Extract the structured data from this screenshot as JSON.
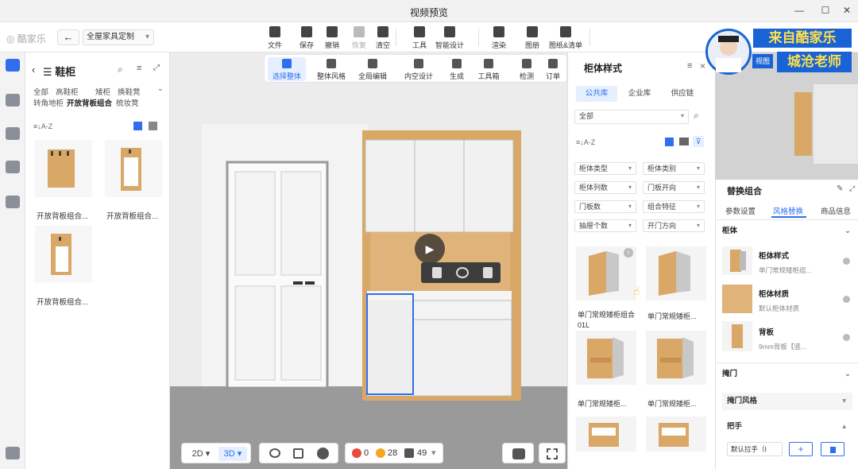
{
  "window": {
    "title": "视频预览",
    "controls": [
      "—",
      "☐",
      "✕"
    ]
  },
  "toolbar": {
    "logo": "酷家乐",
    "back": "←",
    "mode": "全屋家具定制",
    "tools": [
      {
        "label": "文件",
        "dim": false
      },
      {
        "label": "保存",
        "dim": false
      },
      {
        "label": "撤销",
        "dim": false
      },
      {
        "label": "恢复",
        "dim": true
      },
      {
        "label": "清空",
        "dim": false
      },
      {
        "label": "工具",
        "dim": false
      },
      {
        "label": "智能设计",
        "dim": false
      },
      {
        "label": "渲染",
        "dim": false
      },
      {
        "label": "图册",
        "dim": false
      },
      {
        "label": "图纸&清单",
        "dim": false
      }
    ]
  },
  "leftpanel": {
    "title": "鞋柜",
    "categories": [
      [
        "全部",
        "高鞋柜",
        "矮柜",
        "换鞋凳"
      ],
      [
        "转角地柜",
        "开放背板组合",
        "梳妆凳"
      ]
    ],
    "selected_category": "开放背板组合",
    "sort": "A-Z",
    "items": [
      {
        "label": "开放背板组合..."
      },
      {
        "label": "开放背板组合..."
      },
      {
        "label": "开放背板组合..."
      }
    ]
  },
  "center_toolbar": [
    {
      "label": "选择整体",
      "active": true
    },
    {
      "label": "整体风格",
      "active": false
    },
    {
      "label": "全局编辑",
      "active": false
    },
    {
      "label": "内空设计",
      "active": false
    },
    {
      "label": "生成",
      "active": false
    },
    {
      "label": "工具箱",
      "active": false
    },
    {
      "label": "检测",
      "active": false
    },
    {
      "label": "订单",
      "active": false
    }
  ],
  "stylepanel": {
    "title": "柜体样式",
    "tabs": [
      "公共库",
      "企业库",
      "供应链"
    ],
    "selected_tab": "公共库",
    "scope": "全部",
    "sort": "A-Z",
    "filters": [
      "柜体类型",
      "柜体类别",
      "柜体列数",
      "门板开向",
      "门板数",
      "组合特征",
      "抽屉个数",
      "开门方向"
    ],
    "items": [
      {
        "label": "单门常规矮柜组合01L"
      },
      {
        "label": "单门常规矮柜..."
      },
      {
        "label": "单门常规矮柜..."
      },
      {
        "label": "单门常规矮柜..."
      }
    ]
  },
  "rightpanel": {
    "title": "替换组合",
    "tabs": [
      "参数设置",
      "风格替换",
      "商品信息"
    ],
    "selected_tab": "风格替换",
    "section_cabinet": "柜体",
    "rows": [
      {
        "title": "柜体样式",
        "sub": "单门常规矮柜组..."
      },
      {
        "title": "柜体材质",
        "sub": "默认柜体材质"
      },
      {
        "title": "背板",
        "sub": "9mm背板【竖..."
      }
    ],
    "section_door": "掩门",
    "door_style": "掩门风格",
    "handle_section": "把手",
    "handle_value": "默认拉手（I"
  },
  "overlay": {
    "from": "来自酷家乐",
    "teacher": "城沧老师",
    "view": "视图"
  },
  "bottombar": {
    "view2d": "2D",
    "view3d": "3D",
    "errors": "0",
    "warnings": "28",
    "items": "49"
  },
  "colors": {
    "accent": "#2f6fed",
    "wood": "#d9a766",
    "overlay_blue": "#1a63d6",
    "overlay_text": "#ffe04a"
  }
}
